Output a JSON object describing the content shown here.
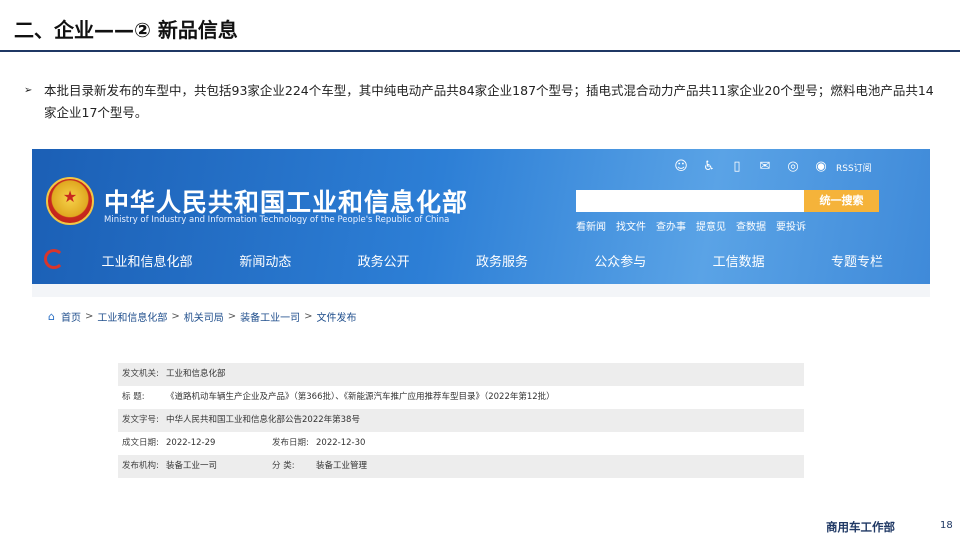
{
  "slide": {
    "title": "二、企业——② 新品信息",
    "bullet": "本批目录新发布的车型中，共包括93家企业224个车型，其中纯电动产品共84家企业187个型号；插电式混合动力产品共11家企业20个型号；燃料电池产品共14家企业17个型号。",
    "footer": "商用车工作部",
    "page_number": "18"
  },
  "site": {
    "name_cn": "中华人民共和国工业和信息化部",
    "name_en": "Ministry of Industry and Information Technology of the People's Republic of China",
    "top_icons": [
      "robot-icon",
      "accessibility-icon",
      "mobile-icon",
      "mail-icon",
      "wechat-icon",
      "weibo-icon"
    ],
    "rss_label": "RSS订阅",
    "search": {
      "placeholder": "",
      "button": "统一搜索"
    },
    "quick_links": [
      "看新闻",
      "找文件",
      "查办事",
      "提意见",
      "查数据",
      "要投诉"
    ],
    "nav": [
      "工业和信息化部",
      "新闻动态",
      "政务公开",
      "政务服务",
      "公众参与",
      "工信数据",
      "专题专栏"
    ],
    "breadcrumb": [
      "首页",
      "工业和信息化部",
      "机关司局",
      "装备工业一司",
      "文件发布"
    ],
    "meta": {
      "issuer_label": "发文机关:",
      "issuer": "工业和信息化部",
      "title_label": "标    题:",
      "title": "《道路机动车辆生产企业及产品》（第366批）、《新能源汽车推广应用推荐车型目录》（2022年第12批）",
      "doc_no_label": "发文字号:",
      "doc_no": "中华人民共和国工业和信息化部公告2022年第38号",
      "created_label": "成文日期:",
      "created": "2022-12-29",
      "published_label": "发布日期:",
      "published": "2022-12-30",
      "org_label": "发布机构:",
      "org": "装备工业一司",
      "category_label": "分    类:",
      "category": "装备工业管理"
    }
  },
  "colors": {
    "title_rule": "#1f3864",
    "header_blue": "#2d7fd6",
    "search_button": "#f5b33a"
  }
}
